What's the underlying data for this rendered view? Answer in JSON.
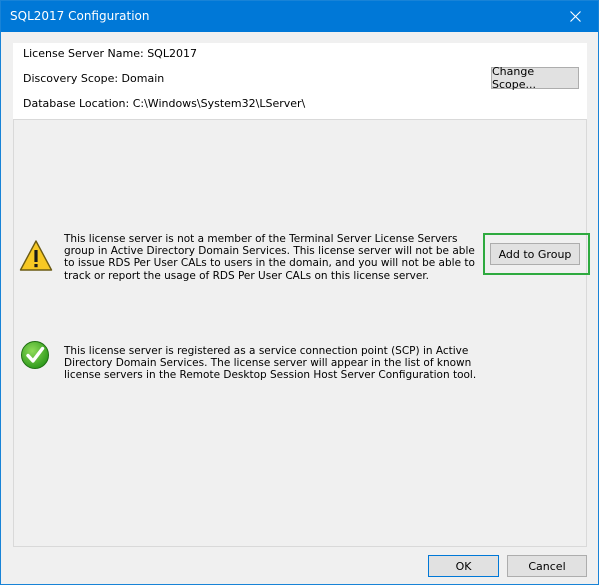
{
  "window": {
    "title": "SQL2017 Configuration",
    "close_icon": "close-icon"
  },
  "info": {
    "license_server_name": "License Server Name: SQL2017",
    "discovery_scope": "Discovery Scope: Domain",
    "database_location": "Database Location: C:\\Windows\\System32\\LServer\\",
    "change_scope_label": "Change Scope..."
  },
  "warning": {
    "icon": "warning-icon",
    "text": "This license server is not a member of the Terminal Server License Servers group in Active Directory Domain Services. This license server will not be able to issue RDS Per User CALs to users in the domain, and you will not be able to track or report the usage of RDS Per User CALs on this license server.",
    "button_label": "Add to Group",
    "highlight_color": "#2eaa3f"
  },
  "success": {
    "icon": "check-icon",
    "text": "This license server is registered as a service connection point (SCP) in Active Directory Domain Services. The license server will appear in the list of known license servers in the Remote Desktop Session Host Server Configuration tool."
  },
  "buttons": {
    "ok_label": "OK",
    "cancel_label": "Cancel"
  },
  "colors": {
    "titlebar": "#0078d7",
    "panel": "#f0f0f0"
  }
}
